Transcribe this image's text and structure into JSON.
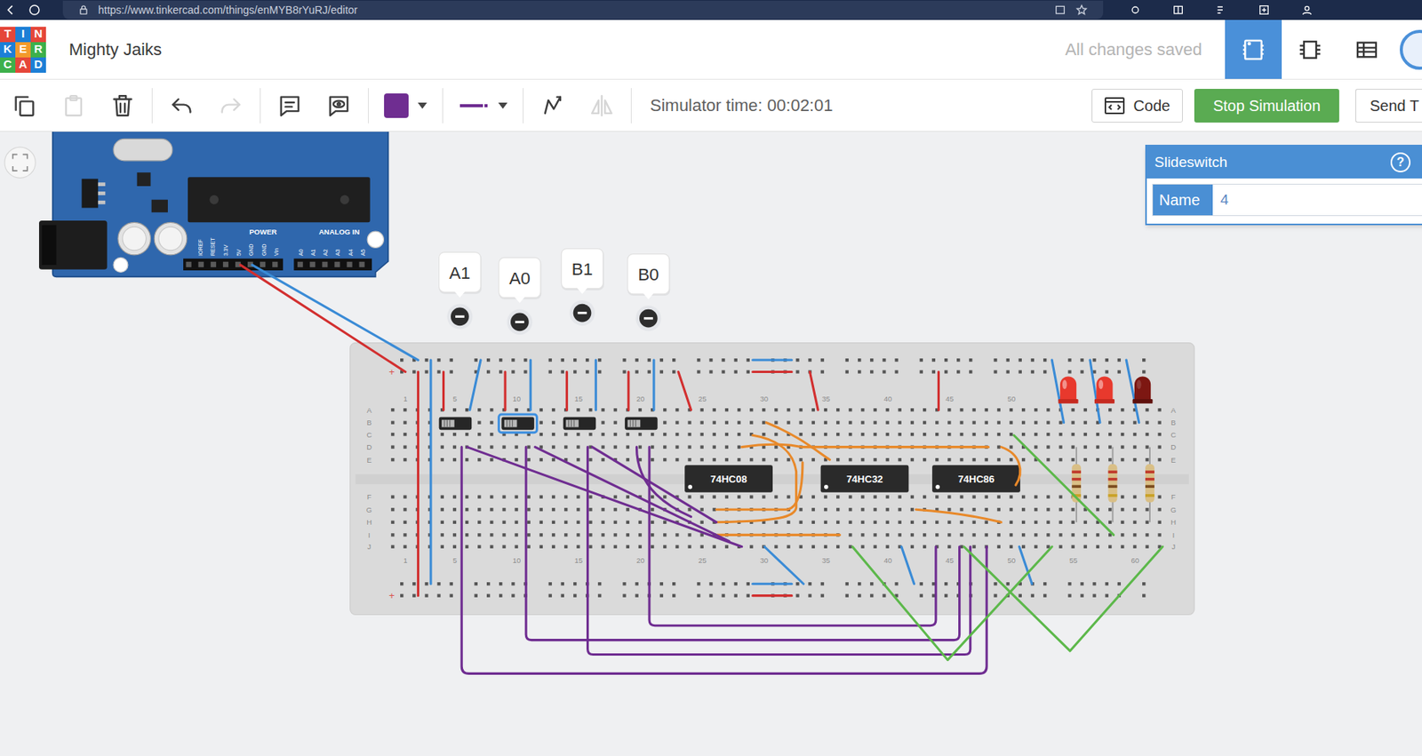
{
  "browser": {
    "url": "https://www.tinkercad.com/things/enMYB8rYuRJ/editor"
  },
  "header": {
    "logo": [
      [
        "T",
        "I",
        "N"
      ],
      [
        "K",
        "E",
        "R"
      ],
      [
        "C",
        "A",
        "D"
      ]
    ],
    "project": "Mighty Jaiks",
    "save_status": "All changes saved",
    "views": [
      {
        "kind": "circuit",
        "selected": true
      },
      {
        "kind": "schematic",
        "selected": false
      },
      {
        "kind": "components",
        "selected": false
      }
    ]
  },
  "toolbar": {
    "tools": [
      {
        "kind": "copy",
        "disabled": false
      },
      {
        "kind": "paste",
        "disabled": true
      },
      {
        "kind": "delete",
        "disabled": false
      },
      {
        "kind": "undo",
        "disabled": false
      },
      {
        "kind": "redo",
        "disabled": true
      },
      {
        "kind": "note",
        "disabled": false
      },
      {
        "kind": "notes-visibility",
        "disabled": false
      },
      {
        "kind": "wire-color",
        "disabled": false,
        "color": "#6f2d91"
      },
      {
        "kind": "wire-type",
        "disabled": false
      },
      {
        "kind": "rotate",
        "disabled": false
      },
      {
        "kind": "flip",
        "disabled": true
      }
    ],
    "simulator_time": "Simulator time: 00:02:01",
    "code_button": "Code",
    "simulate_button": "Stop Simulation",
    "send_button": "Send T"
  },
  "inspector": {
    "title": "Slideswitch",
    "help": "?",
    "name_label": "Name",
    "name_value": "4"
  },
  "arduino": {
    "power_label": "POWER",
    "analog_label": "ANALOG IN",
    "power_pins": [
      "IOREF",
      "RESET",
      "3.3V",
      "5V",
      "GND",
      "GND",
      "Vin"
    ],
    "analog_pins": [
      "A0",
      "A1",
      "A2",
      "A3",
      "A4",
      "A5"
    ]
  },
  "notes": [
    {
      "label": "A1"
    },
    {
      "label": "A0"
    },
    {
      "label": "B1"
    },
    {
      "label": "B0"
    }
  ],
  "switches": [
    {
      "selected": false
    },
    {
      "selected": true
    },
    {
      "selected": false
    },
    {
      "selected": false
    }
  ],
  "chips": [
    {
      "label": "74HC08"
    },
    {
      "label": "74HC32"
    },
    {
      "label": "74HC86"
    }
  ],
  "leds": [
    {
      "on": true
    },
    {
      "on": true
    },
    {
      "on": false
    }
  ],
  "breadboard": {
    "column_numbers_top": [
      "1",
      "5",
      "10",
      "15",
      "20",
      "25",
      "30",
      "35",
      "40",
      "45",
      "50"
    ],
    "column_numbers_bottom": [
      "1",
      "5",
      "10",
      "15",
      "20",
      "25",
      "30",
      "35",
      "40",
      "45",
      "50",
      "55",
      "60"
    ],
    "row_letters": [
      "A",
      "B",
      "C",
      "D",
      "E",
      "F",
      "G",
      "H",
      "I",
      "J"
    ],
    "rail_signs": {
      "top": "+",
      "bottom": "+"
    }
  }
}
